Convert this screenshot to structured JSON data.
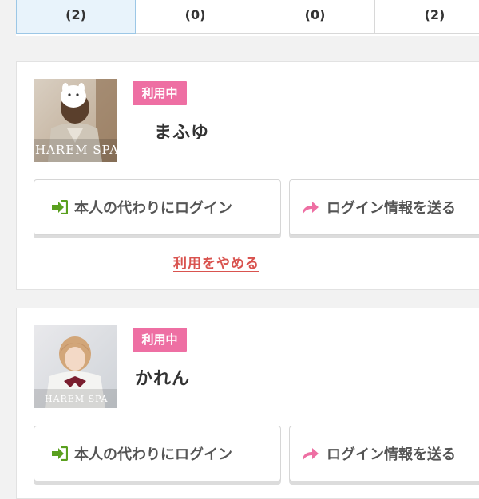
{
  "tabs": [
    {
      "label": "",
      "count": "(2)",
      "active": true
    },
    {
      "label": "",
      "count": "(0)",
      "active": false
    },
    {
      "label": "",
      "count": "(0)",
      "active": false
    },
    {
      "label": "",
      "count": "(2)",
      "active": false
    }
  ],
  "cards": [
    {
      "status": "利用中",
      "name": "まふゆ",
      "thumb_caption": "HAREM SPA",
      "login_label": "本人の代わりにログイン",
      "send_label": "ログイン情報を送る",
      "stop_label": "利用をやめる"
    },
    {
      "status": "利用中",
      "name": "かれん",
      "thumb_caption": "HAREM SPA",
      "login_label": "本人の代わりにログイン",
      "send_label": "ログイン情報を送る"
    }
  ],
  "colors": {
    "badge": "#ee6fa3",
    "active_tab_bg": "#e8f3fb",
    "login_icon": "#5aa01f",
    "send_icon": "#ee6fa3",
    "stop_link": "#d9534f"
  }
}
